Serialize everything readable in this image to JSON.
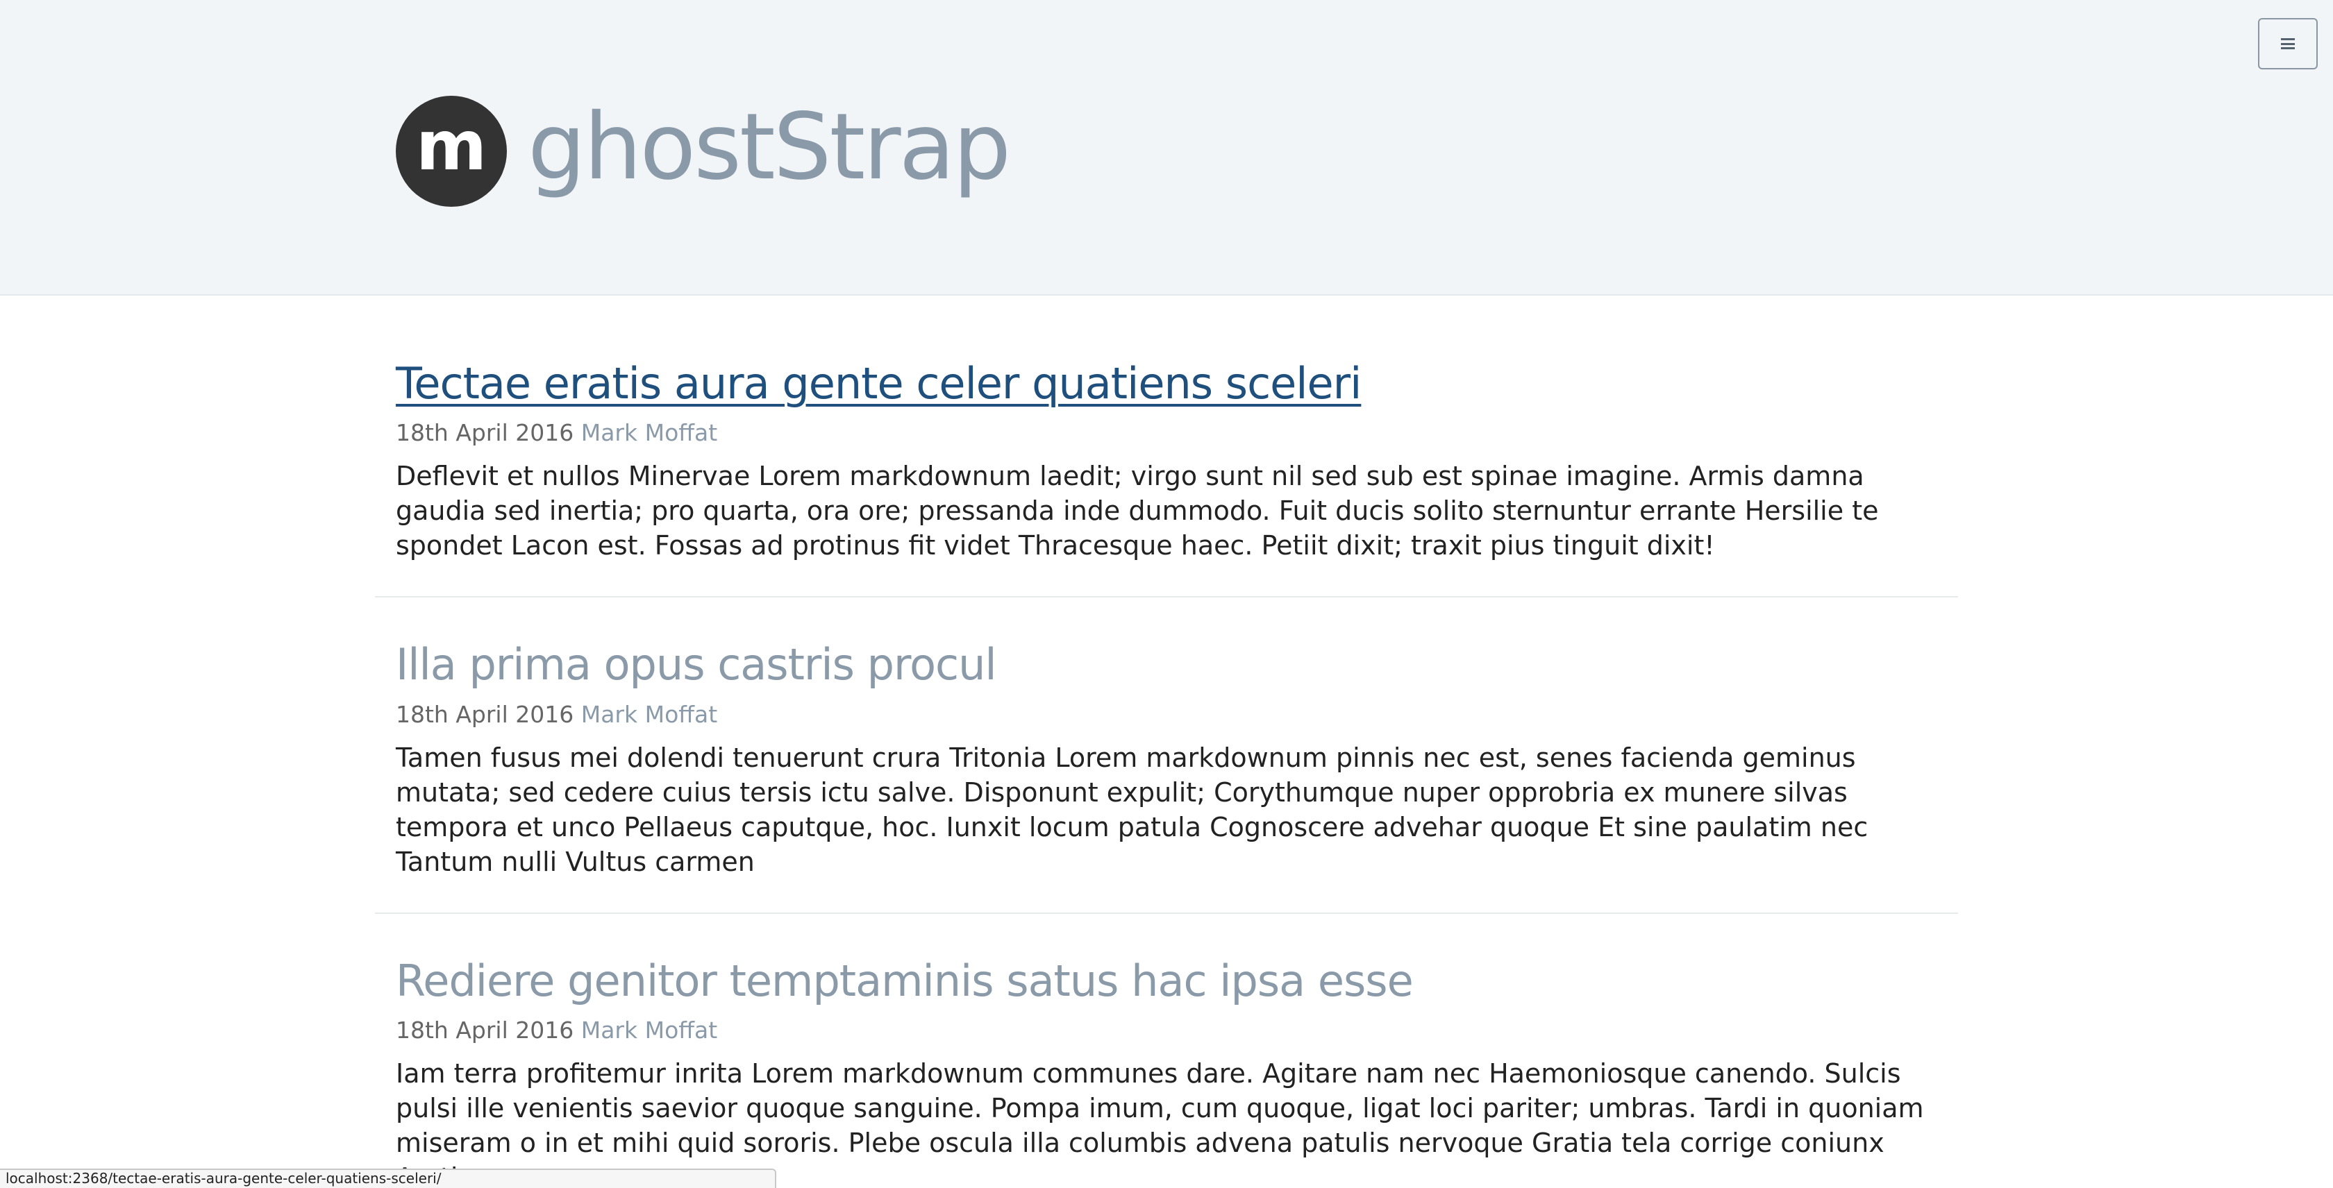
{
  "header": {
    "logo_letter": "m",
    "site_title": "ghostStrap",
    "menu_icon": "hamburger-icon"
  },
  "posts": [
    {
      "title": "Tectae eratis aura gente celer quatiens sceleri",
      "date": "18th April 2016",
      "author": "Mark Moffat",
      "excerpt": "Deflevit et nullos Minervae Lorem markdownum laedit; virgo sunt nil sed sub est spinae imagine. Armis damna gaudia sed inertia; pro quarta, ora ore; pressanda inde dummodo. Fuit ducis solito sternuntur errante Hersilie te spondet Lacon est. Fossas ad protinus fit videt Thracesque haec. Petiit dixit; traxit pius tinguit dixit!"
    },
    {
      "title": "Illa prima opus castris procul",
      "date": "18th April 2016",
      "author": "Mark Moffat",
      "excerpt": "Tamen fusus mei dolendi tenuerunt crura Tritonia Lorem markdownum pinnis nec est, senes facienda geminus mutata; sed cedere cuius tersis ictu salve. Disponunt expulit; Corythumque nuper opprobria ex munere silvas tempora et unco Pellaeus caputque, hoc. Iunxit locum patula Cognoscere advehar quoque Et sine paulatim nec Tantum nulli Vultus carmen"
    },
    {
      "title": "Rediere genitor temptaminis satus hac ipsa esse",
      "date": "18th April 2016",
      "author": "Mark Moffat",
      "excerpt": "Iam terra profitemur inrita Lorem markdownum communes dare. Agitare nam nec Haemoniosque canendo. Sulcis pulsi ille venientis saevior quoque sanguine. Pompa imum, cum quoque, ligat loci pariter; umbras. Tardi in quoniam miseram o in et mihi quid sororis. Plebe oscula illa columbis advena patulis nervoque Gratia tela corrige coniunx Arethusa"
    }
  ],
  "status_bar": {
    "url": "localhost:2368/tectae-eratis-aura-gente-celer-quatiens-sceleri/"
  },
  "colors": {
    "header_bg": "#f2f5f8",
    "title_muted": "#8a9aa8",
    "link_active": "#1e4f7d",
    "logo_bg": "#333333"
  }
}
